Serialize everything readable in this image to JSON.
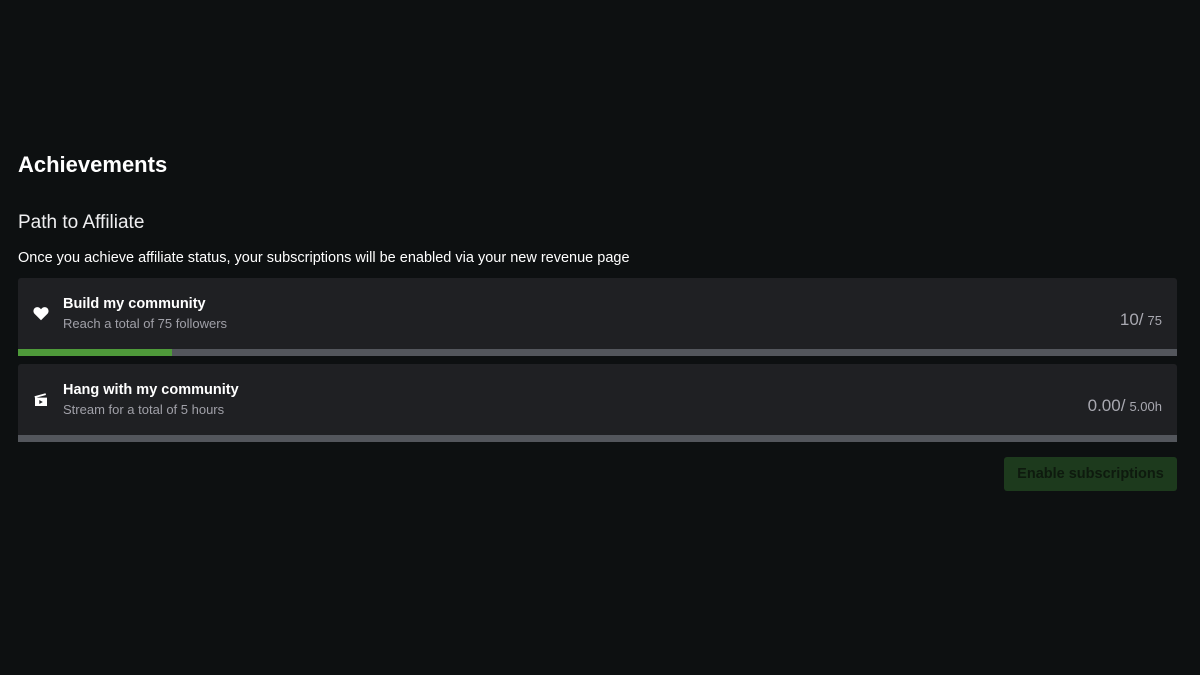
{
  "header": {
    "title": "Achievements",
    "subtitle": "Path to Affiliate",
    "description": "Once you achieve affiliate status, your subscriptions will be enabled via your new revenue page"
  },
  "achievements": [
    {
      "icon": "heart-icon",
      "name": "Build my community",
      "description": "Reach a total of 75 followers",
      "current": "10",
      "slash": "/",
      "target": "75",
      "progress_fraction": 0.1333
    },
    {
      "icon": "camera-icon",
      "name": "Hang with my community",
      "description": "Stream for a total of 5 hours",
      "current": "0.00",
      "slash": "/",
      "target": "5.00h",
      "progress_fraction": 0
    }
  ],
  "actions": {
    "enable_label": "Enable subscriptions"
  },
  "colors": {
    "background": "#0d1011",
    "card": "#1f2023",
    "progress_fill": "#4e9a3a",
    "progress_track": "#53565c",
    "button_bg": "#1d3a1d"
  }
}
